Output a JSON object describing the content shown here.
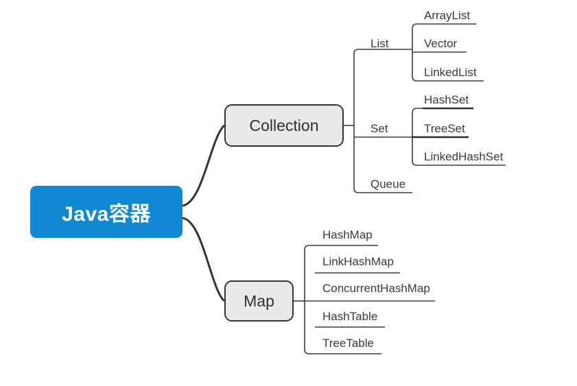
{
  "diagram": {
    "type": "mindmap",
    "background_color": "#ffffff",
    "root": {
      "label": "Java容器",
      "fill_color": "#1189d2",
      "text_color": "#ffffff"
    },
    "branch_style": {
      "fill_color": "#e9e9e9",
      "border_color": "#333333",
      "text_color": "#2f2f2f"
    },
    "line_color": "#3a3a3a",
    "branches": [
      {
        "label": "Collection",
        "children": [
          {
            "label": "List",
            "children": [
              {
                "label": "ArrayList"
              },
              {
                "label": "Vector"
              },
              {
                "label": "LinkedList"
              }
            ]
          },
          {
            "label": "Set",
            "children": [
              {
                "label": "HashSet"
              },
              {
                "label": "TreeSet"
              },
              {
                "label": "LinkedHashSet"
              }
            ]
          },
          {
            "label": "Queue",
            "children": []
          }
        ]
      },
      {
        "label": "Map",
        "children": [
          {
            "label": "HashMap"
          },
          {
            "label": "LinkHashMap"
          },
          {
            "label": "ConcurrentHashMap"
          },
          {
            "label": "HashTable"
          },
          {
            "label": "TreeTable"
          }
        ]
      }
    ]
  }
}
